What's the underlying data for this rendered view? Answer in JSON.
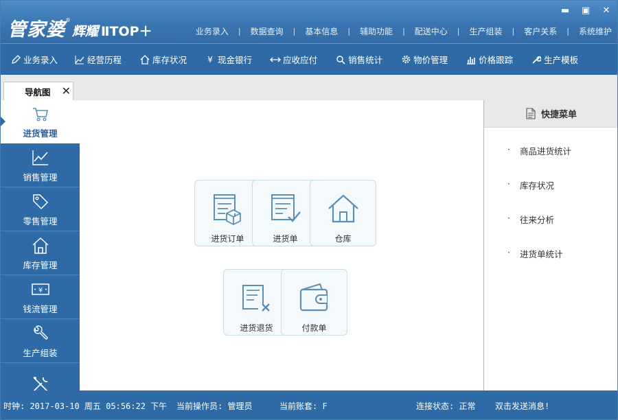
{
  "brand": {
    "name": "管家婆",
    "registered": "®",
    "edition": "辉耀",
    "version": "ⅡTOP＋"
  },
  "window_controls": {
    "minimize": "▬",
    "maximize": "▣",
    "close": "✕"
  },
  "top_menu": [
    "业务录入",
    "数据查询",
    "基本信息",
    "辅助功能",
    "配送中心",
    "生产组装",
    "客户关系",
    "系统维护"
  ],
  "top_menu_separator": "|",
  "nav": [
    {
      "label": "业务录入",
      "icon": "edit-icon"
    },
    {
      "label": "经营历程",
      "icon": "trend-icon"
    },
    {
      "label": "库存状况",
      "icon": "home-icon"
    },
    {
      "label": "现金银行",
      "icon": "yen-icon"
    },
    {
      "label": "应收应付",
      "icon": "exchange-icon"
    },
    {
      "label": "销售统计",
      "icon": "search-icon"
    },
    {
      "label": "物价管理",
      "icon": "gear-icon"
    },
    {
      "label": "价格跟踪",
      "icon": "bar-chart-icon"
    },
    {
      "label": "生产模板",
      "icon": "wrench-icon"
    }
  ],
  "tab": {
    "label": "导航图",
    "close": "✕"
  },
  "sidebar": [
    {
      "label": "进货管理",
      "icon": "cart-icon",
      "active": true
    },
    {
      "label": "销售管理",
      "icon": "trend-icon",
      "active": false
    },
    {
      "label": "零售管理",
      "icon": "tag-icon",
      "active": false
    },
    {
      "label": "库存管理",
      "icon": "home-icon",
      "active": false
    },
    {
      "label": "钱流管理",
      "icon": "money-icon",
      "active": false
    },
    {
      "label": "生产组装",
      "icon": "wrench-icon",
      "active": false
    },
    {
      "label": "",
      "icon": "tools-icon",
      "active": false
    }
  ],
  "tiles": [
    {
      "label": "进货订单",
      "icon": "purchase-order-icon"
    },
    {
      "label": "进货单",
      "icon": "purchase-bill-icon"
    },
    {
      "label": "仓库",
      "icon": "warehouse-icon"
    },
    {
      "label": "进货退货",
      "icon": "purchase-return-icon"
    },
    {
      "label": "付款单",
      "icon": "wallet-icon"
    }
  ],
  "quick_menu": {
    "title": "快捷菜单",
    "items": [
      "商品进货统计",
      "库存状况",
      "往来分析",
      "进货单统计"
    ]
  },
  "status": {
    "clock": "时钟: 2017-03-10 周五 05:56:22 下午",
    "operator": "当前操作员: 管理员",
    "account": "当前账套: F",
    "connection": "连接状态: 正常",
    "message": "双击发送消息!"
  },
  "colors": {
    "primary": "#2e6aa6",
    "topbar": "#3a76b2",
    "tile_border": "#c9dde8",
    "icon_blue": "#5b8fb3"
  }
}
